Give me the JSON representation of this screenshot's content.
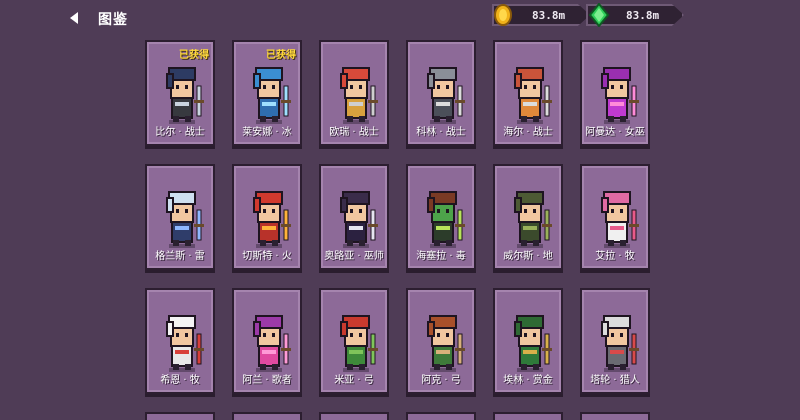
{
  "header": {
    "title": "图鉴",
    "gold": {
      "icon": "gold-coin-icon",
      "value": "83.8m"
    },
    "gem": {
      "icon": "green-gem-icon",
      "value": "83.8m"
    }
  },
  "owned_label": "已获得",
  "cards": [
    {
      "name": "比尔 · 战士",
      "owned": true,
      "hair": "#2d3b63",
      "skin": "#f1c7a0",
      "outfit": "#37393f",
      "accent": "#c9d3df"
    },
    {
      "name": "莱安娜 · 冰",
      "owned": true,
      "hair": "#3b8ed1",
      "skin": "#f1c7a0",
      "outfit": "#2f6eb0",
      "accent": "#9fe0ff"
    },
    {
      "name": "欧瑞 · 战士",
      "owned": false,
      "hair": "#d84a3a",
      "skin": "#f1c7a0",
      "outfit": "#d8a13e",
      "accent": "#cfcfcf"
    },
    {
      "name": "科林 · 战士",
      "owned": false,
      "hair": "#8a8f98",
      "skin": "#f1c7a0",
      "outfit": "#4b4f59",
      "accent": "#dcdcdc"
    },
    {
      "name": "海尔 · 战士",
      "owned": false,
      "hair": "#c9543a",
      "skin": "#f1c7a0",
      "outfit": "#e0883a",
      "accent": "#dcdcdc"
    },
    {
      "name": "阿曼达 · 女巫",
      "owned": false,
      "hair": "#9a2fb0",
      "skin": "#f1c7a0",
      "outfit": "#c03ad1",
      "accent": "#ff8bd9"
    },
    {
      "name": "格兰斯 · 雷",
      "owned": false,
      "hair": "#cfe0f0",
      "skin": "#f1c7a0",
      "outfit": "#2f3d6a",
      "accent": "#8fb8ff"
    },
    {
      "name": "切斯特 · 火",
      "owned": false,
      "hair": "#d0392e",
      "skin": "#f1c7a0",
      "outfit": "#b8322a",
      "accent": "#ffb23a"
    },
    {
      "name": "奥路亚 · 巫师",
      "owned": false,
      "hair": "#3a2c4a",
      "skin": "#f1c7a0",
      "outfit": "#2b2140",
      "accent": "#e6e6f0"
    },
    {
      "name": "海塞拉 · 毒",
      "owned": false,
      "hair": "#7a3a24",
      "skin": "#4da34a",
      "outfit": "#2c3c2a",
      "accent": "#b7e35a"
    },
    {
      "name": "威尔斯 · 地",
      "owned": false,
      "hair": "#4d5a34",
      "skin": "#f1c7a0",
      "outfit": "#3b4a2c",
      "accent": "#9ab05a"
    },
    {
      "name": "艾拉 · 牧",
      "owned": false,
      "hair": "#e06aa3",
      "skin": "#f1c7a0",
      "outfit": "#f0f0f0",
      "accent": "#e85a8a"
    },
    {
      "name": "希恩 · 牧",
      "owned": false,
      "hair": "#f4f4f4",
      "skin": "#f1c7a0",
      "outfit": "#e8e8e8",
      "accent": "#d8403a"
    },
    {
      "name": "阿兰 · 歌者",
      "owned": false,
      "hair": "#9c3aa8",
      "skin": "#f1c7a0",
      "outfit": "#e04aa0",
      "accent": "#ff9ad6"
    },
    {
      "name": "米亚 · 弓",
      "owned": false,
      "hair": "#c93a2e",
      "skin": "#f1c7a0",
      "outfit": "#3e8a3a",
      "accent": "#7fc45a"
    },
    {
      "name": "阿克 · 弓",
      "owned": false,
      "hair": "#a8502a",
      "skin": "#f1c7a0",
      "outfit": "#3e7a3a",
      "accent": "#d8b07a"
    },
    {
      "name": "埃林 · 赏金",
      "owned": false,
      "hair": "#2e6a34",
      "skin": "#f1c7a0",
      "outfit": "#2f7a3a",
      "accent": "#d8b04a"
    },
    {
      "name": "塔轮 · 猎人",
      "owned": false,
      "hair": "#dcdcdc",
      "skin": "#f1c7a0",
      "outfit": "#6a6a72",
      "accent": "#d84a4a"
    }
  ],
  "partial_cards": [
    "",
    "",
    "",
    "",
    "",
    ""
  ]
}
